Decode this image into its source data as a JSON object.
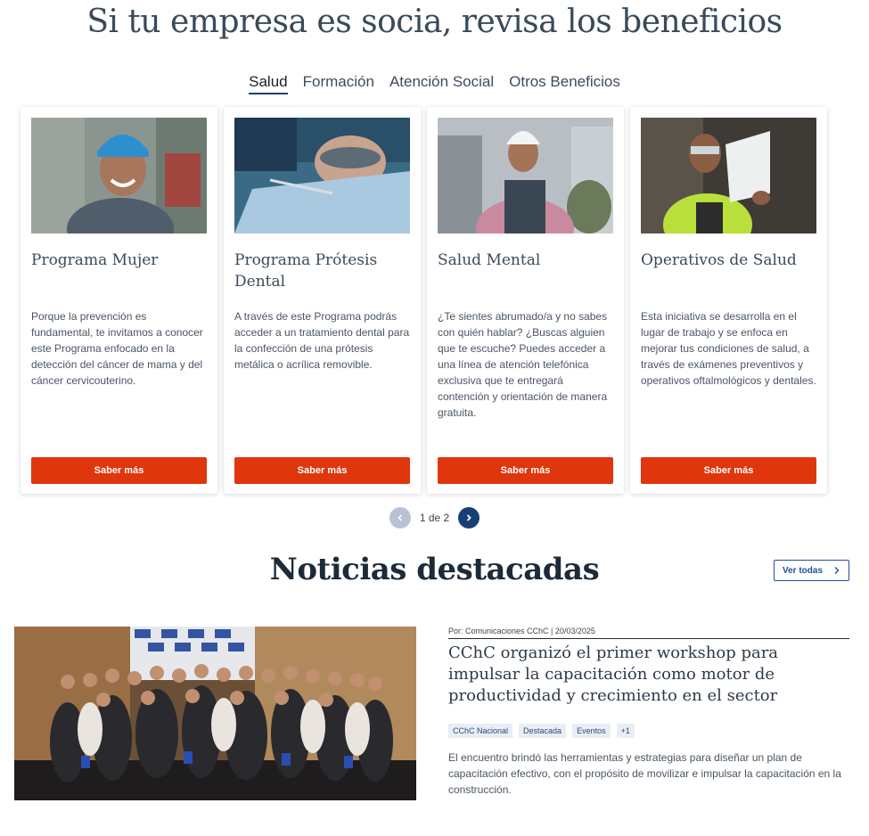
{
  "benefits": {
    "title": "Si tu empresa es socia, revisa los beneficios",
    "tabs": [
      "Salud",
      "Formación",
      "Atención Social",
      "Otros Beneficios"
    ],
    "active_tab": "Salud",
    "cards": [
      {
        "title": "Programa Mujer",
        "text": "Porque la prevención es fundamental, te invitamos a conocer este Programa enfocado en la detección del cáncer de mama y del cáncer cervicouterino.",
        "button": "Saber más"
      },
      {
        "title": "Programa Prótesis Dental",
        "text": "A través de este Programa podrás acceder a un tratamiento dental para la confección de una prótesis metálica o acrílica removible.",
        "button": "Saber más"
      },
      {
        "title": "Salud Mental",
        "text": "¿Te sientes abrumado/a y no sabes con quién hablar? ¿Buscas alguien que te escuche? Puedes acceder a una línea de atención telefónica exclusiva que te entregará contención y orientación de manera gratuita.",
        "button": "Saber más"
      },
      {
        "title": "Operativos de Salud",
        "text": "Esta iniciativa se desarrolla en el lugar de trabajo y se enfoca en mejorar tus condiciones de salud, a través de exámenes preventivos y operativos oftalmológicos y dentales.",
        "button": "Saber más"
      }
    ],
    "pager": {
      "text": "1 de 2"
    }
  },
  "news": {
    "title": "Noticias destacadas",
    "see_all": "Ver todas",
    "item": {
      "meta": "Por: Comunicaciones CChC | 20/03/2025",
      "headline": "CChC organizó el primer workshop para impulsar la capacitación como motor de productividad y crecimiento en el sector",
      "tags": [
        "CChC Nacional",
        "Destacada",
        "Eventos",
        "+1"
      ],
      "summary": "El encuentro brindó las herramientas y estrategias para diseñar un plan de capacitación efectivo, con el propósito de movilizar e impulsar la capacitación en la construcción."
    }
  },
  "colors": {
    "accent": "#e0360d",
    "navy": "#173f76",
    "link": "#1e4f96"
  },
  "icons": {
    "prev": "chevron-left-icon",
    "next": "chevron-right-icon",
    "see_all": "chevron-right-icon"
  }
}
